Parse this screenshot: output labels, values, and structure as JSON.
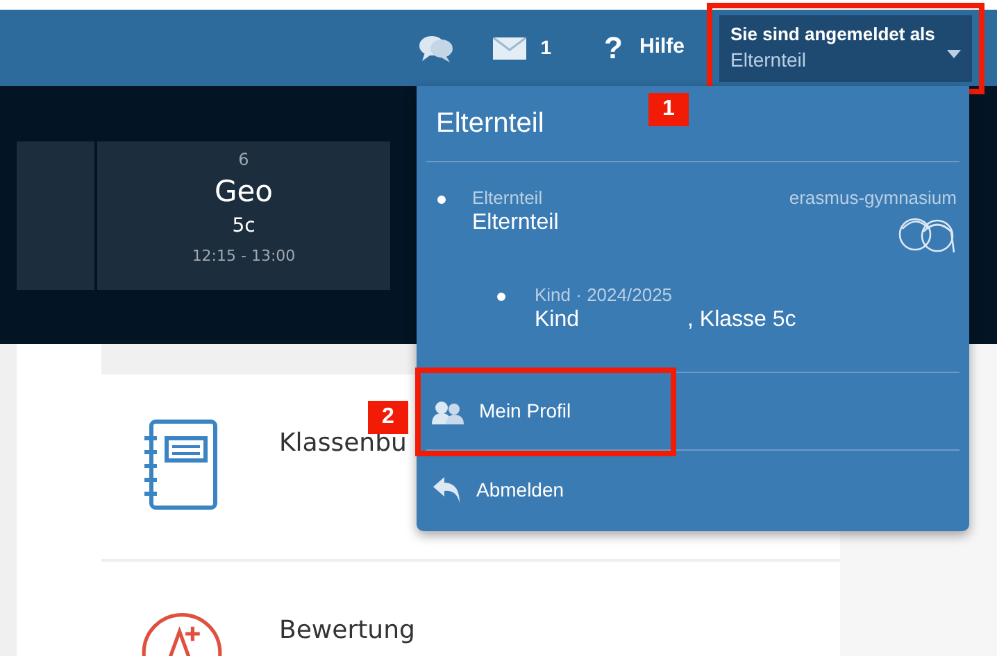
{
  "topbar": {
    "message_count": "1",
    "help_icon": "?",
    "help": "Hilfe",
    "login": {
      "label": "Sie sind angemeldet als",
      "role": "Elternteil",
      "expanded": true
    }
  },
  "timetable": {
    "lessons": [
      {
        "number": "6",
        "subject": "Geo",
        "class": "5c",
        "time": "12:15 - 13:00"
      }
    ]
  },
  "tiles": [
    {
      "kind": "classbook",
      "label": "Klassenbu"
    },
    {
      "kind": "grading",
      "label": "Bewertung"
    }
  ],
  "menu": {
    "title": "Elternteil",
    "accounts": [
      {
        "role": "Elternteil",
        "name": "Elternteil",
        "school": "erasmus-gymnasium",
        "children": [
          {
            "role": "Kind · 2024/2025",
            "name": "Kind",
            "class": ", Klasse 5c"
          }
        ]
      }
    ],
    "items": [
      {
        "kind": "profile",
        "label": "Mein Profil"
      },
      {
        "kind": "logout",
        "label": "Abmelden"
      }
    ]
  },
  "annotations": [
    {
      "label": "1"
    },
    {
      "label": "2"
    }
  ]
}
